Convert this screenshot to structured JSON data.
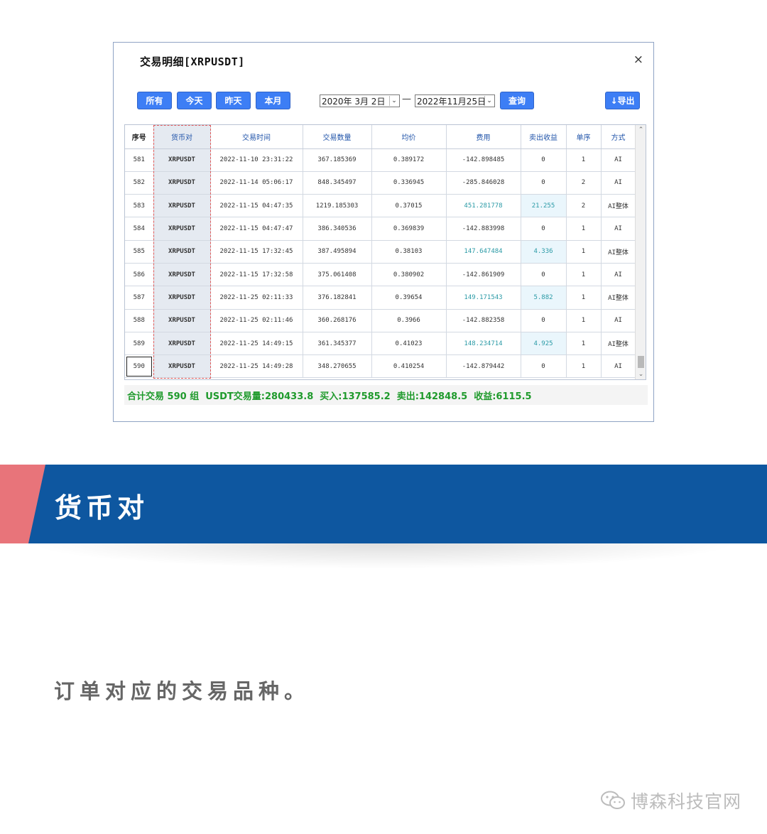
{
  "dialog": {
    "title": "交易明细[XRPUSDT]",
    "close_glyph": "×",
    "buttons": {
      "all": "所有",
      "today": "今天",
      "yesterday": "昨天",
      "this_month": "本月",
      "query": "查询",
      "export": "↓导出"
    },
    "date_from": "2020年 3月  2日",
    "date_to": "2022年11月25日",
    "date_separator": "—"
  },
  "table": {
    "headers": [
      "序号",
      "货币对",
      "交易时间",
      "交易数量",
      "均价",
      "费用",
      "卖出收益",
      "单序",
      "方式"
    ],
    "rows": [
      [
        "581",
        "XRPUSDT",
        "2022-11-10 23:31:22",
        "367.185369",
        "0.389172",
        "-142.898485",
        "0",
        "1",
        "AI"
      ],
      [
        "582",
        "XRPUSDT",
        "2022-11-14 05:06:17",
        "848.345497",
        "0.336945",
        "-285.846028",
        "0",
        "2",
        "AI"
      ],
      [
        "583",
        "XRPUSDT",
        "2022-11-15 04:47:35",
        "1219.185303",
        "0.37015",
        "451.281778",
        "21.255",
        "2",
        "AI整体"
      ],
      [
        "584",
        "XRPUSDT",
        "2022-11-15 04:47:47",
        "386.340536",
        "0.369839",
        "-142.883998",
        "0",
        "1",
        "AI"
      ],
      [
        "585",
        "XRPUSDT",
        "2022-11-15 17:32:45",
        "387.495894",
        "0.38103",
        "147.647484",
        "4.336",
        "1",
        "AI整体"
      ],
      [
        "586",
        "XRPUSDT",
        "2022-11-15 17:32:58",
        "375.061408",
        "0.380902",
        "-142.861909",
        "0",
        "1",
        "AI"
      ],
      [
        "587",
        "XRPUSDT",
        "2022-11-25 02:11:33",
        "376.182841",
        "0.39654",
        "149.171543",
        "5.882",
        "1",
        "AI整体"
      ],
      [
        "588",
        "XRPUSDT",
        "2022-11-25 02:11:46",
        "360.268176",
        "0.3966",
        "-142.882358",
        "0",
        "1",
        "AI"
      ],
      [
        "589",
        "XRPUSDT",
        "2022-11-25 14:49:15",
        "361.345377",
        "0.41023",
        "148.234714",
        "4.925",
        "1",
        "AI整体"
      ],
      [
        "590",
        "XRPUSDT",
        "2022-11-25 14:49:28",
        "348.270655",
        "0.410254",
        "-142.879442",
        "0",
        "1",
        "AI"
      ]
    ],
    "positive_color": "#2a9aa6",
    "selected_row_index": 9
  },
  "summary": {
    "total": "合计交易 590 组",
    "usdt_volume": "USDT交易量:280433.8",
    "buy": "买入:137585.2",
    "sell": "卖出:142848.5",
    "profit": "收益:6115.5",
    "color": "#1f9a2c"
  },
  "banner": {
    "title": "货币对",
    "blue": "#0e57a0",
    "red": "#e8747a"
  },
  "description": "订单对应的交易品种。",
  "watermark": {
    "icon": "wechat-icon",
    "text": "博森科技官网"
  }
}
